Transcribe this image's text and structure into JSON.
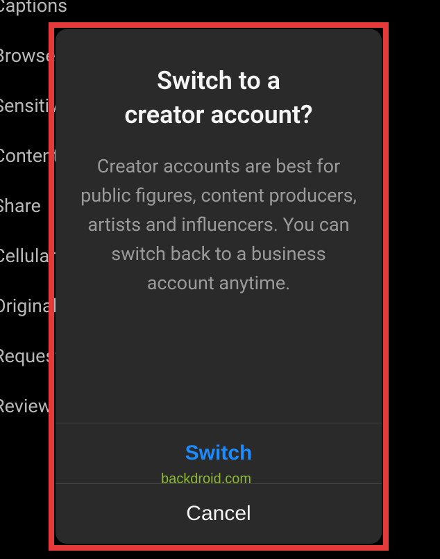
{
  "background": {
    "items": [
      "Captions",
      "Browse",
      "Sensitive",
      "Content",
      "Share",
      "Cellular",
      "Original",
      "Request",
      "Review activity"
    ]
  },
  "dialog": {
    "title_line1": "Switch to a",
    "title_line2": "creator account?",
    "description": "Creator accounts are best for public figures, content producers, artists and influencers. You can switch back to a business account anytime.",
    "switch_label": "Switch",
    "cancel_label": "Cancel",
    "watermark": "backdroid.com"
  }
}
